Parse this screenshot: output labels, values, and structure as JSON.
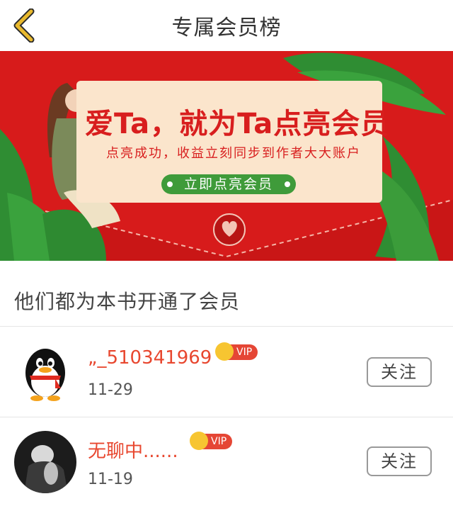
{
  "header": {
    "title": "专属会员榜",
    "back_icon": "chevron-left-icon",
    "back_color": "#e9b92d"
  },
  "banner": {
    "headline": "爱Ta，就为Ta点亮会员",
    "subtitle": "点亮成功，收益立刻同步到作者大大账户",
    "cta_label": "立即点亮会员",
    "colors": {
      "background": "#d71b1b",
      "card": "#fbe5cc",
      "cta": "#3f9b3a"
    }
  },
  "section": {
    "title": "他们都为本书开通了会员"
  },
  "members": [
    {
      "name": "„_510341969",
      "badge": "VIP",
      "date": "11-29",
      "follow_label": "关注",
      "avatar": "qq-penguin-avatar"
    },
    {
      "name": "无聊中......",
      "badge": "VIP",
      "date": "11-19",
      "follow_label": "关注",
      "avatar": "photo-avatar"
    }
  ]
}
